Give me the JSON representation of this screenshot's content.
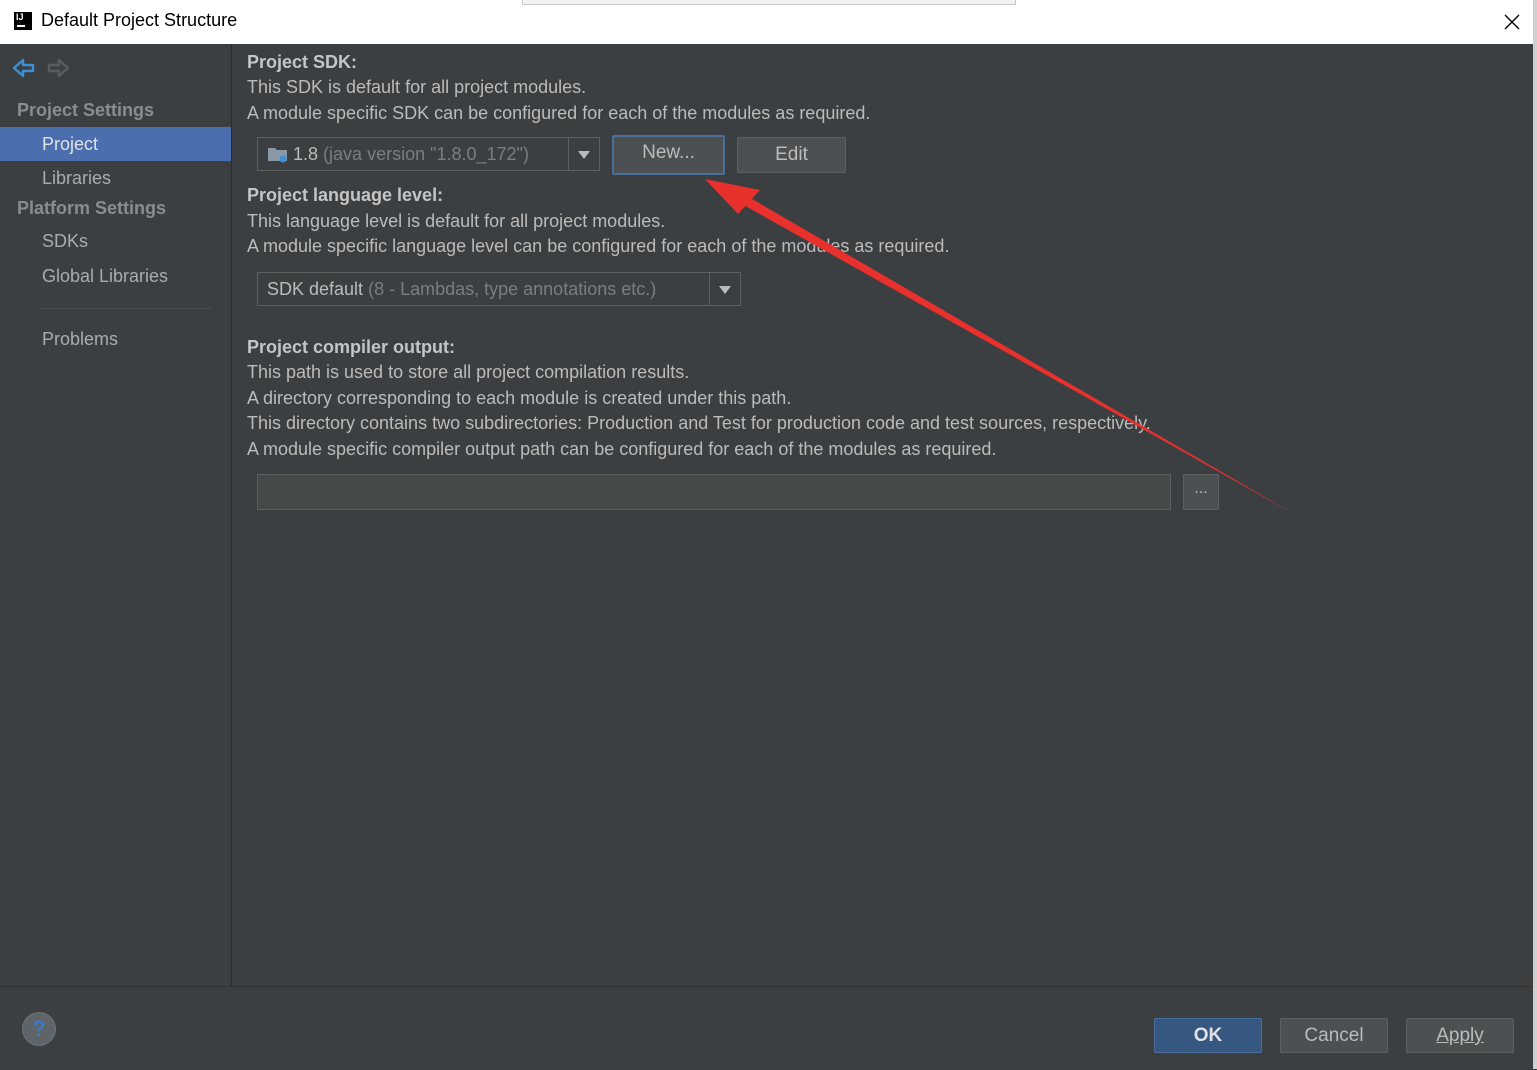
{
  "window": {
    "title": "Default Project Structure"
  },
  "sidebar": {
    "sections": [
      {
        "label": "Project Settings"
      },
      {
        "label": "Platform Settings"
      }
    ],
    "items": [
      {
        "label": "Project"
      },
      {
        "label": "Libraries"
      },
      {
        "label": "SDKs"
      },
      {
        "label": "Global Libraries"
      },
      {
        "label": "Problems"
      }
    ],
    "selected": "Project"
  },
  "sdk": {
    "heading": "Project SDK:",
    "desc1": "This SDK is default for all project modules.",
    "desc2": "A module specific SDK can be configured for each of the modules as required.",
    "selected_version": "1.8",
    "selected_detail": "(java version \"1.8.0_172\")",
    "new_button": "New...",
    "edit_button": "Edit"
  },
  "language": {
    "heading": "Project language level:",
    "desc1": "This language level is default for all project modules.",
    "desc2": "A module specific language level can be configured for each of the modules as required.",
    "selected": "SDK default",
    "selected_detail": "(8 - Lambdas, type annotations etc.)"
  },
  "compiler": {
    "heading": "Project compiler output:",
    "desc1": "This path is used to store all project compilation results.",
    "desc2": "A directory corresponding to each module is created under this path.",
    "desc3": "This directory contains two subdirectories: Production and Test for production code and test sources, respectively.",
    "desc4": "A module specific compiler output path can be configured for each of the modules as required.",
    "output_path": "",
    "browse_button": "..."
  },
  "footer": {
    "help": "?",
    "ok": "OK",
    "cancel": "Cancel",
    "apply": "Apply"
  },
  "colors": {
    "background": "#3c3f41",
    "selection": "#4b6eaf",
    "annotation": "#e8302c"
  }
}
